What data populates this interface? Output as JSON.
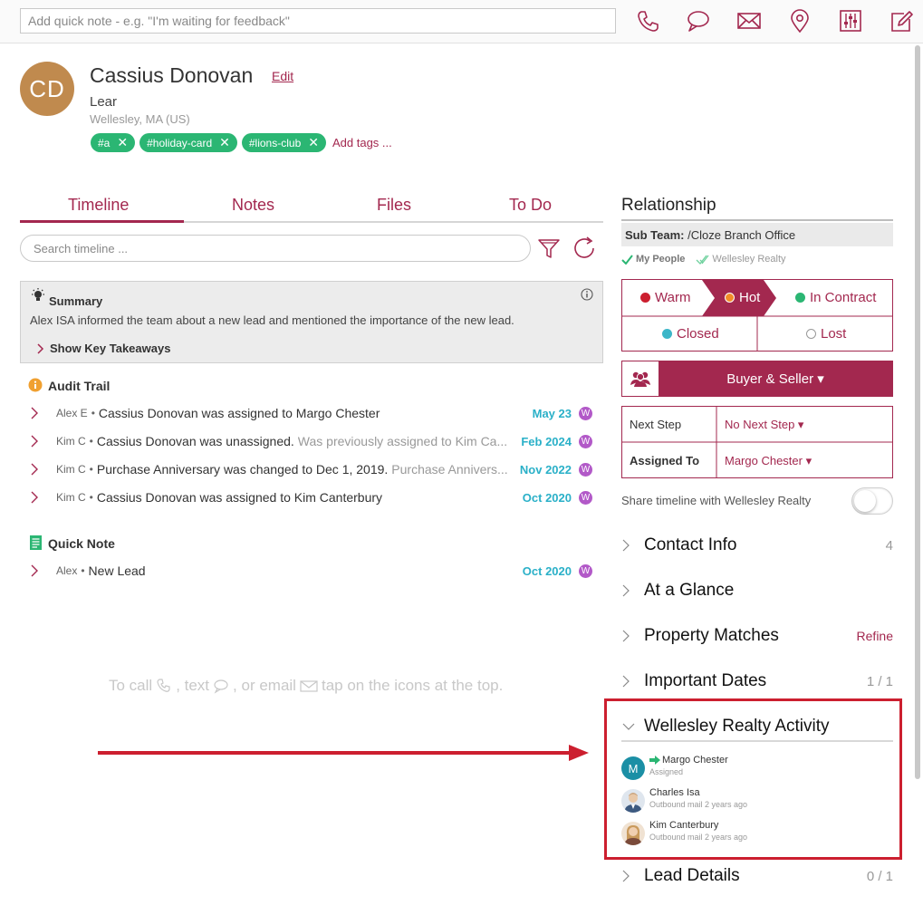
{
  "quick_note": {
    "placeholder": "Add quick note - e.g. \"I'm waiting for feedback\""
  },
  "contact": {
    "initials": "CD",
    "name": "Cassius Donovan",
    "edit_label": "Edit",
    "title": "Lear",
    "location": "Wellesley, MA (US)",
    "tags": [
      "#a",
      "#holiday-card",
      "#lions-club"
    ],
    "add_tags_label": "Add tags ..."
  },
  "tabs": [
    "Timeline",
    "Notes",
    "Files",
    "To Do"
  ],
  "active_tab": "Timeline",
  "search": {
    "placeholder": "Search timeline ..."
  },
  "summary": {
    "title": "Summary",
    "text": "Alex ISA informed the team about a new lead and mentioned the importance of the new lead.",
    "toggle_label": "Show Key Takeaways"
  },
  "audit_trail": {
    "title": "Audit Trail",
    "items": [
      {
        "who": "Alex E",
        "text": "Cassius Donovan was assigned to Margo Chester",
        "grey": "",
        "date": "May 23"
      },
      {
        "who": "Kim C",
        "text": "Cassius Donovan was unassigned.",
        "grey": "Was previously assigned to Kim Ca...",
        "date": "Feb 2024"
      },
      {
        "who": "Kim C",
        "text": "Purchase Anniversary was changed to Dec 1, 2019.",
        "grey": "Purchase Annivers...",
        "date": "Nov 2022"
      },
      {
        "who": "Kim C",
        "text": "Cassius Donovan was assigned to Kim Canterbury",
        "grey": "",
        "date": "Oct 2020"
      }
    ]
  },
  "quick_note_section": {
    "title": "Quick Note",
    "items": [
      {
        "who": "Alex",
        "text": "New Lead",
        "date": "Oct 2020"
      }
    ]
  },
  "badge_letter": "W",
  "hint": {
    "part1": "To call",
    "part2": ", text",
    "part3": ", or email",
    "part4": "tap on the icons at the top."
  },
  "relationship": {
    "title": "Relationship",
    "subteam_label": "Sub Team:",
    "subteam_value": "/Cloze Branch Office",
    "checks": [
      "My People",
      "Wellesley Realty"
    ],
    "statuses": {
      "warm": "Warm",
      "hot": "Hot",
      "in_contract": "In Contract",
      "closed": "Closed",
      "lost": "Lost"
    },
    "selected_status": "Hot",
    "role": "Buyer & Seller ▾",
    "next_step_label": "Next Step",
    "next_step_value": "No Next Step ▾",
    "assigned_label": "Assigned To",
    "assigned_value": "Margo Chester ▾",
    "share_label": "Share timeline with Wellesley Realty",
    "share_on": false
  },
  "sections": {
    "contact_info": {
      "label": "Contact Info",
      "meta": "4"
    },
    "at_a_glance": {
      "label": "At a Glance"
    },
    "property_matches": {
      "label": "Property Matches",
      "meta": "Refine"
    },
    "important_dates": {
      "label": "Important Dates",
      "meta": "1 / 1"
    },
    "activity": {
      "label": "Wellesley Realty Activity"
    },
    "lead_details": {
      "label": "Lead Details",
      "meta": "0 / 1"
    }
  },
  "activity": [
    {
      "initial": "M",
      "name": "Margo Chester",
      "sub": "Assigned"
    },
    {
      "name": "Charles Isa",
      "sub": "Outbound mail 2 years ago"
    },
    {
      "name": "Kim Canterbury",
      "sub": "Outbound mail 2 years ago"
    }
  ],
  "colors": {
    "brand": "#a3284f",
    "tag": "#2bb673",
    "date": "#2ab0c8",
    "badge": "#b259c8",
    "highlight": "#cc1f2f"
  }
}
